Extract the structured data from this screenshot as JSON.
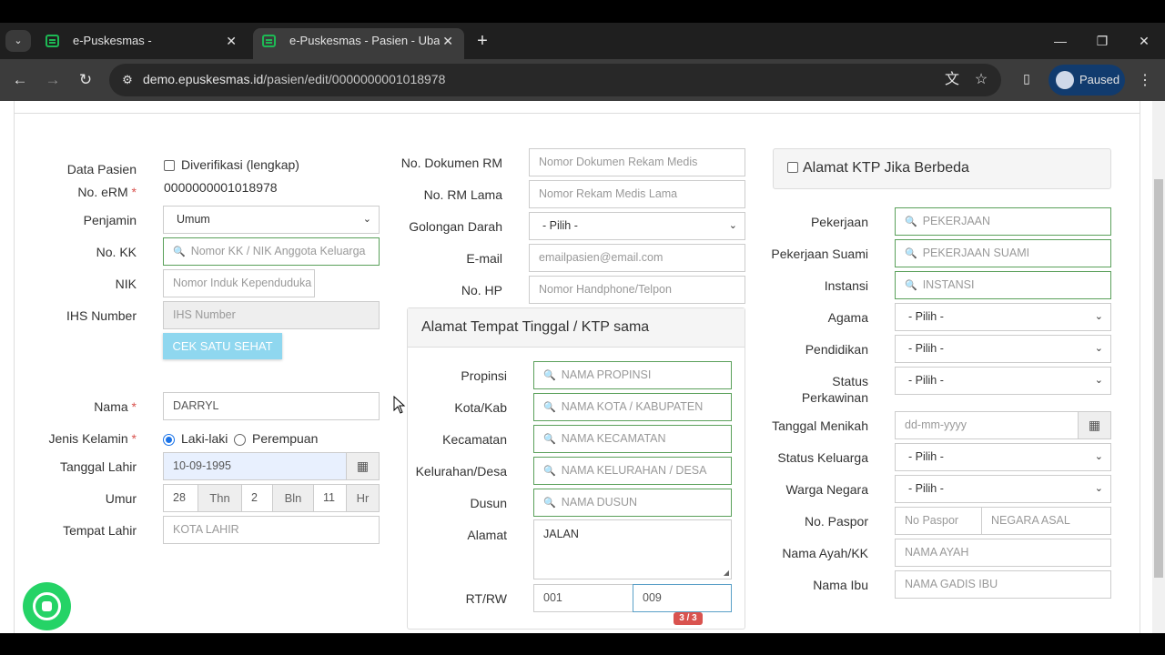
{
  "browser": {
    "tab1_title": "e-Puskesmas -",
    "tab2_title": "e-Puskesmas - Pasien - Ubah Data",
    "url_host": "demo.epuskesmas.id",
    "url_path": "/pasien/edit/0000000001018978",
    "profile_label": "Paused"
  },
  "left": {
    "data_pasien_label": "Data Pasien",
    "diverifikasi_label": "Diverifikasi (lengkap)",
    "no_erm_label": "No. eRM",
    "no_erm_value": "0000000001018978",
    "penjamin_label": "Penjamin",
    "penjamin_value": "Umum",
    "no_kk_label": "No. KK",
    "no_kk_placeholder": "Nomor KK / NIK Anggota Keluarga",
    "nik_label": "NIK",
    "nik_placeholder": "Nomor Induk Kependuduka",
    "ihs_label": "IHS Number",
    "ihs_placeholder": "IHS Number",
    "cek_button": "CEK SATU SEHAT",
    "nama_label": "Nama",
    "nama_value": "DARRYL",
    "jenis_kelamin_label": "Jenis Kelamin",
    "laki_label": "Laki-laki",
    "perempuan_label": "Perempuan",
    "tanggal_lahir_label": "Tanggal Lahir",
    "tanggal_lahir_value": "10-09-1995",
    "umur_label": "Umur",
    "umur_thn": "28",
    "thn_label": "Thn",
    "umur_bln": "2",
    "bln_label": "Bln",
    "umur_hr": "11",
    "hr_label": "Hr",
    "tempat_lahir_label": "Tempat Lahir",
    "tempat_lahir_placeholder": "KOTA LAHIR"
  },
  "middle": {
    "no_dokumen_label": "No. Dokumen RM",
    "no_dokumen_placeholder": "Nomor Dokumen Rekam Medis",
    "no_rm_lama_label": "No. RM Lama",
    "no_rm_lama_placeholder": "Nomor Rekam Medis Lama",
    "golongan_label": "Golongan Darah",
    "golongan_value": "- Pilih -",
    "email_label": "E-mail",
    "email_placeholder": "emailpasien@email.com",
    "no_hp_label": "No. HP",
    "no_hp_placeholder": "Nomor Handphone/Telpon",
    "alamat_box_title": "Alamat Tempat Tinggal / KTP sama",
    "propinsi_label": "Propinsi",
    "propinsi_placeholder": "NAMA PROPINSI",
    "kota_label": "Kota/Kab",
    "kota_placeholder": "NAMA KOTA / KABUPATEN",
    "kecamatan_label": "Kecamatan",
    "kecamatan_placeholder": "NAMA KECAMATAN",
    "kelurahan_label": "Kelurahan/Desa",
    "kelurahan_placeholder": "NAMA KELURAHAN / DESA",
    "dusun_label": "Dusun",
    "dusun_placeholder": "NAMA DUSUN",
    "alamat_label": "Alamat",
    "alamat_value": "JALAN",
    "rtrw_label": "RT/RW",
    "rt_value": "001",
    "rw_value": "009",
    "rw_badge": "3 / 3"
  },
  "right": {
    "ktp_box_title": "Alamat KTP Jika Berbeda",
    "pekerjaan_label": "Pekerjaan",
    "pekerjaan_placeholder": "PEKERJAAN",
    "pekerjaan_suami_label": "Pekerjaan Suami",
    "pekerjaan_suami_placeholder": "PEKERJAAN SUAMI",
    "instansi_label": "Instansi",
    "instansi_placeholder": "INSTANSI",
    "agama_label": "Agama",
    "agama_value": "- Pilih -",
    "pendidikan_label": "Pendidikan",
    "pendidikan_value": "- Pilih -",
    "status_perkawinan_label_1": "Status",
    "status_perkawinan_label_2": "Perkawinan",
    "status_perkawinan_value": "- Pilih -",
    "tanggal_menikah_label": "Tanggal Menikah",
    "tanggal_menikah_placeholder": "dd-mm-yyyy",
    "status_keluarga_label": "Status Keluarga",
    "status_keluarga_value": "- Pilih -",
    "warga_negara_label": "Warga Negara",
    "warga_negara_value": "- Pilih -",
    "no_paspor_label": "No. Paspor",
    "no_paspor_placeholder": "No Paspor",
    "negara_asal_placeholder": "NEGARA ASAL",
    "nama_ayah_label": "Nama Ayah/KK",
    "nama_ayah_placeholder": "NAMA AYAH",
    "nama_ibu_label": "Nama Ibu",
    "nama_ibu_placeholder": "NAMA GADIS IBU"
  }
}
